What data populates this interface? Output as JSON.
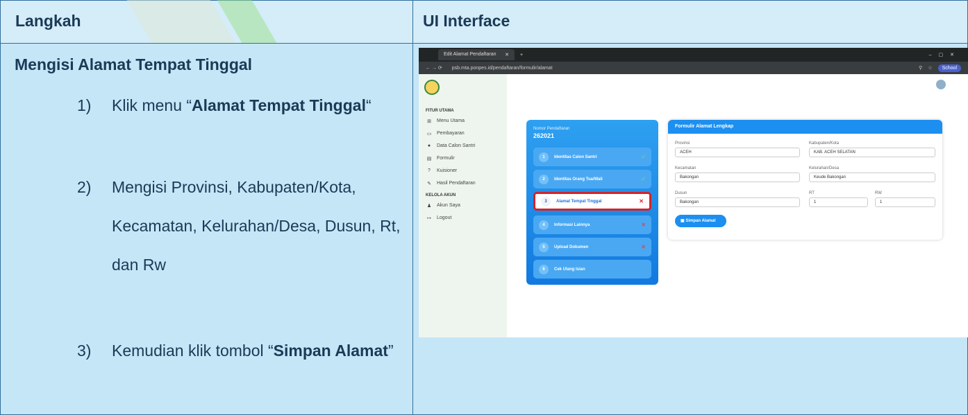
{
  "table": {
    "col1_header": "Langkah",
    "col2_header": "UI Interface"
  },
  "left": {
    "heading": "Mengisi Alamat Tempat Tinggal",
    "steps": [
      {
        "num": "1)",
        "pre": "Klik menu “",
        "bold": "Alamat Tempat Tinggal",
        "post": "“"
      },
      {
        "num": "2)",
        "text": "Mengisi Provinsi, Kabupaten/Kota, Kecamatan, Kelurahan/Desa, Dusun, Rt, dan Rw"
      },
      {
        "num": "3)",
        "pre": "Kemudian klik tombol “",
        "bold": "Simpan Alamat",
        "post": "”"
      }
    ]
  },
  "browser": {
    "tab_title": "Edit Alamat Pendaftaran",
    "url": "psb.mta.ponpes.id/pendaftaran/formulir/alamat",
    "profile": "School"
  },
  "sidebar": {
    "sec1": "FITUR UTAMA",
    "items": [
      "Menu Utama",
      "Pembayaran",
      "Data Calon Santri",
      "Formulir",
      "Kuisioner",
      "Hasil Pendaftaran"
    ],
    "sec2": "KELOLA AKUN",
    "items2": [
      "Akun Saya",
      "Logout"
    ]
  },
  "reg": {
    "label": "Nomor Pendaftaran",
    "number": "262021",
    "steps": [
      {
        "n": "1",
        "label": "Identitas Calon Santri",
        "mark": "✓"
      },
      {
        "n": "2",
        "label": "Identitas Orang Tua/Wali",
        "mark": "✓"
      },
      {
        "n": "3",
        "label": "Alamat Tempat Tinggal",
        "mark": "✕"
      },
      {
        "n": "4",
        "label": "Informasi Lainnya",
        "mark": "✕"
      },
      {
        "n": "5",
        "label": "Upload Dokumen",
        "mark": "✕"
      },
      {
        "n": "6",
        "label": "Cek Ulang Isian",
        "mark": ""
      }
    ]
  },
  "form": {
    "title": "Formulir Alamat Lengkap",
    "provinsi_label": "Provinsi",
    "provinsi": "ACEH",
    "kab_label": "Kabupaten/Kota",
    "kab": "KAB. ACEH SELATAN",
    "kec_label": "Kecamatan",
    "kec": "Bakongan",
    "kel_label": "Kelurahan/Desa",
    "kel": "Keude Bakongan",
    "dusun_label": "Dusun",
    "dusun": "Bakongan",
    "rt_label": "RT",
    "rt": "1",
    "rw_label": "RW",
    "rw": "1",
    "save": "Simpan Alamat"
  }
}
